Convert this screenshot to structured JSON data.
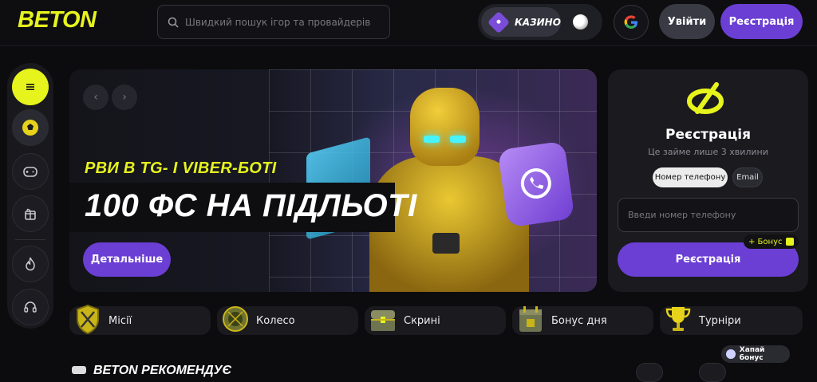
{
  "header": {
    "logo": "BETON",
    "search_placeholder": "Швидкий пошук ігор та провайдерів",
    "mode_casino": "КАЗИНО",
    "login": "Увійти",
    "register": "Реєстрація"
  },
  "banner": {
    "subtitle": "РВИ В TG- І VIBER-БОТІ",
    "title": "100 ФС НА ПІДЛЬОТІ",
    "cta": "Детальніше"
  },
  "registration": {
    "title": "Реєстрація",
    "subtitle": "Це займе лише 3 хвилини",
    "tab_phone": "Номер телефону",
    "tab_email": "Email",
    "phone_placeholder": "Введи номер телефону",
    "submit": "Реєстрація",
    "bonus_badge": "+ Бонус"
  },
  "features": [
    {
      "label": "Місії",
      "icon": "shield-swords-icon"
    },
    {
      "label": "Колесо",
      "icon": "wheel-icon"
    },
    {
      "label": "Скрині",
      "icon": "chest-icon"
    },
    {
      "label": "Бонус дня",
      "icon": "calendar-gift-icon"
    },
    {
      "label": "Турніри",
      "icon": "trophy-icon"
    }
  ],
  "section": {
    "title": "BETON РЕКОМЕНДУЄ"
  },
  "chat_chip": "Хапай бонус",
  "colors": {
    "accent": "#e6f31d",
    "primary": "#6b3fd4",
    "background": "#0c0c0f",
    "card": "#1a1a1f"
  }
}
